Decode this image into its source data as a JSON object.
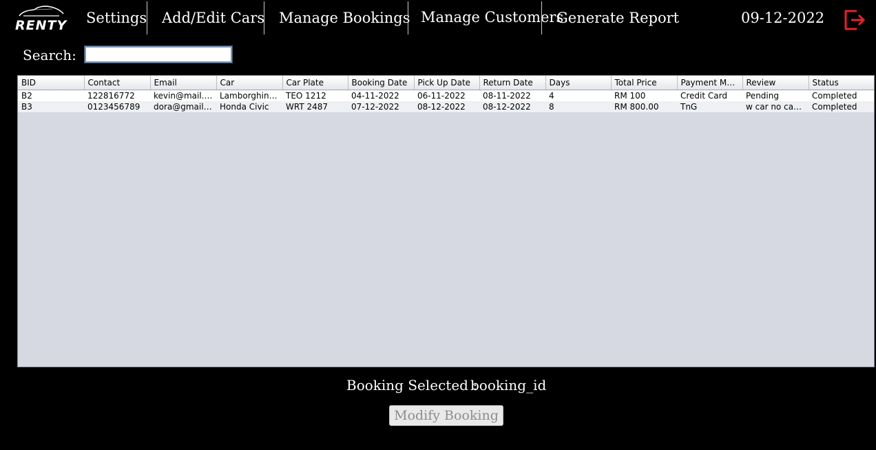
{
  "app": {
    "logo_text": "RENTY"
  },
  "nav": {
    "items": [
      {
        "label": "Settings"
      },
      {
        "label": "Add/Edit Cars"
      },
      {
        "label": "Manage Bookings"
      },
      {
        "label": "Manage Customers"
      },
      {
        "label": "Generate Report"
      }
    ],
    "date": "09-12-2022",
    "logout_icon": "logout-icon",
    "logout_color": "#e8202a"
  },
  "search": {
    "label": "Search:",
    "value": ""
  },
  "table": {
    "columns": [
      "BID",
      "Contact",
      "Email",
      "Car",
      "Car Plate",
      "Booking Date",
      "Pick Up Date",
      "Return Date",
      "Days",
      "Total Price",
      "Payment Met...",
      "Review",
      "Status"
    ],
    "rows": [
      [
        "B2",
        "122816772",
        "kevin@mail.c...",
        "Lamborghini ...",
        "TEO 1212",
        "04-11-2022",
        "06-11-2022",
        "08-11-2022",
        "4",
        "RM 100",
        "Credit Card",
        "Pending",
        "Completed"
      ],
      [
        "B3",
        "0123456789",
        "dora@gmail.c...",
        "Honda Civic",
        "WRT 2487",
        "07-12-2022",
        "08-12-2022",
        "08-12-2022",
        "8",
        "RM 800.00",
        "TnG",
        "w car no cap f...",
        "Completed"
      ]
    ]
  },
  "selection": {
    "label": "Booking Selected :",
    "value": "booking_id"
  },
  "actions": {
    "modify_label": "Modify Booking"
  }
}
